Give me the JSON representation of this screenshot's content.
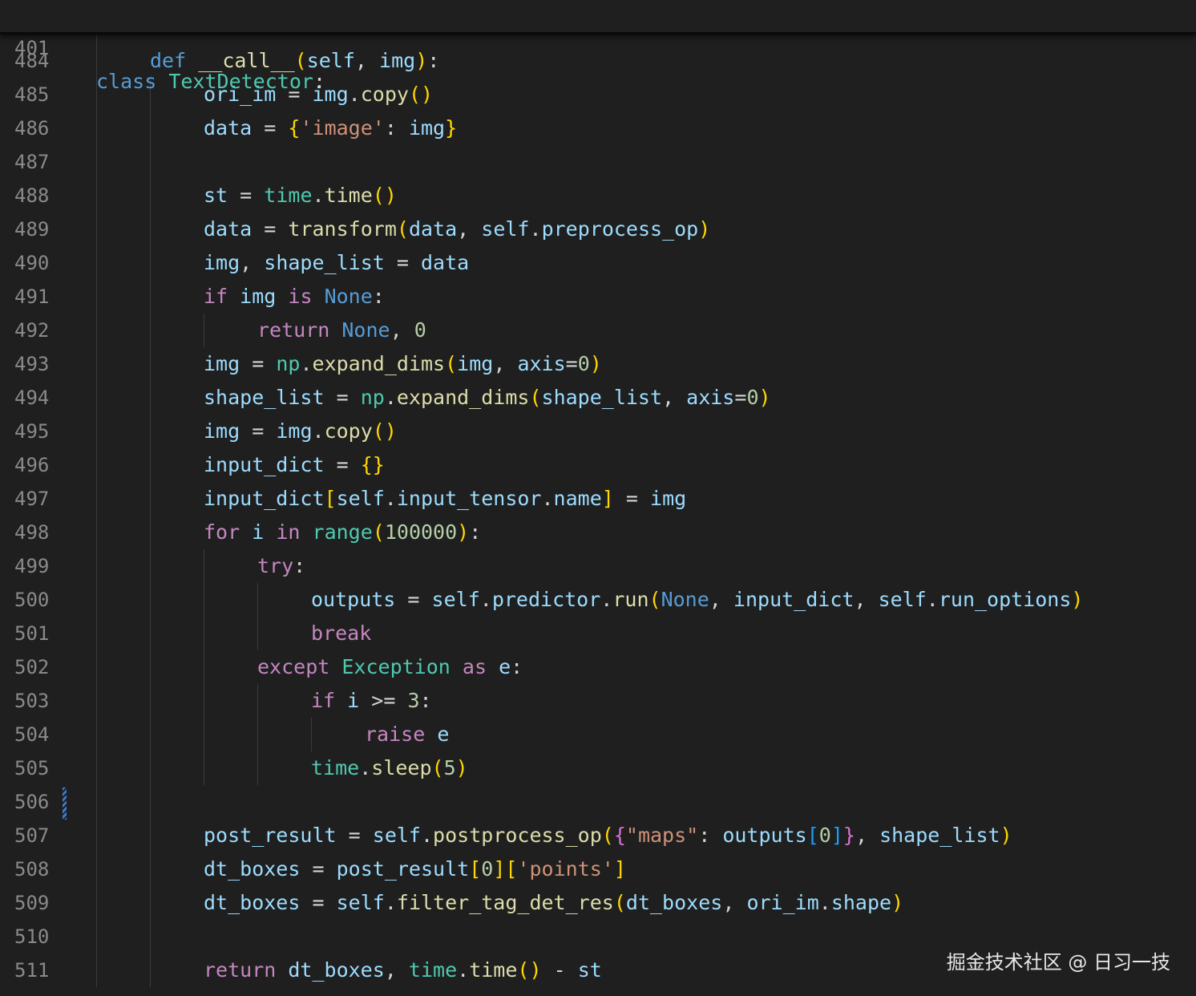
{
  "sticky_header": {
    "line_number": "401",
    "code": "class TextDetector:"
  },
  "lines": [
    {
      "n": "484",
      "indent": 1,
      "code": "def __call__(self, img):"
    },
    {
      "n": "485",
      "indent": 2,
      "code": "ori_im = img.copy()"
    },
    {
      "n": "486",
      "indent": 2,
      "code": "data = {'image': img}"
    },
    {
      "n": "487",
      "indent": 0,
      "code": ""
    },
    {
      "n": "488",
      "indent": 2,
      "code": "st = time.time()"
    },
    {
      "n": "489",
      "indent": 2,
      "code": "data = transform(data, self.preprocess_op)"
    },
    {
      "n": "490",
      "indent": 2,
      "code": "img, shape_list = data"
    },
    {
      "n": "491",
      "indent": 2,
      "code": "if img is None:"
    },
    {
      "n": "492",
      "indent": 3,
      "code": "return None, 0"
    },
    {
      "n": "493",
      "indent": 2,
      "code": "img = np.expand_dims(img, axis=0)"
    },
    {
      "n": "494",
      "indent": 2,
      "code": "shape_list = np.expand_dims(shape_list, axis=0)"
    },
    {
      "n": "495",
      "indent": 2,
      "code": "img = img.copy()"
    },
    {
      "n": "496",
      "indent": 2,
      "code": "input_dict = {}"
    },
    {
      "n": "497",
      "indent": 2,
      "code": "input_dict[self.input_tensor.name] = img"
    },
    {
      "n": "498",
      "indent": 2,
      "code": "for i in range(100000):"
    },
    {
      "n": "499",
      "indent": 3,
      "code": "try:"
    },
    {
      "n": "500",
      "indent": 4,
      "code": "outputs = self.predictor.run(None, input_dict, self.run_options)"
    },
    {
      "n": "501",
      "indent": 4,
      "code": "break"
    },
    {
      "n": "502",
      "indent": 3,
      "code": "except Exception as e:"
    },
    {
      "n": "503",
      "indent": 4,
      "code": "if i >= 3:"
    },
    {
      "n": "504",
      "indent": 5,
      "code": "raise e"
    },
    {
      "n": "505",
      "indent": 4,
      "code": "time.sleep(5)"
    },
    {
      "n": "506",
      "indent": 0,
      "code": ""
    },
    {
      "n": "507",
      "indent": 2,
      "code": "post_result = self.postprocess_op({\"maps\": outputs[0]}, shape_list)"
    },
    {
      "n": "508",
      "indent": 2,
      "code": "dt_boxes = post_result[0]['points']"
    },
    {
      "n": "509",
      "indent": 2,
      "code": "dt_boxes = self.filter_tag_det_res(dt_boxes, ori_im.shape)"
    },
    {
      "n": "510",
      "indent": 0,
      "code": ""
    },
    {
      "n": "511",
      "indent": 2,
      "code": "return dt_boxes, time.time() - st"
    }
  ],
  "watermark": "掘金技术社区 @ 日习一技",
  "colors": {
    "background": "#1f1f1f",
    "line_number": "#8a8a8a",
    "keyword": "#c586c0",
    "builtin_keyword": "#569cd6",
    "class_name": "#4ec9b0",
    "function": "#dcdcaa",
    "string": "#ce9178",
    "bracket_gold": "#ffd700",
    "bracket_blue": "#179fff"
  }
}
